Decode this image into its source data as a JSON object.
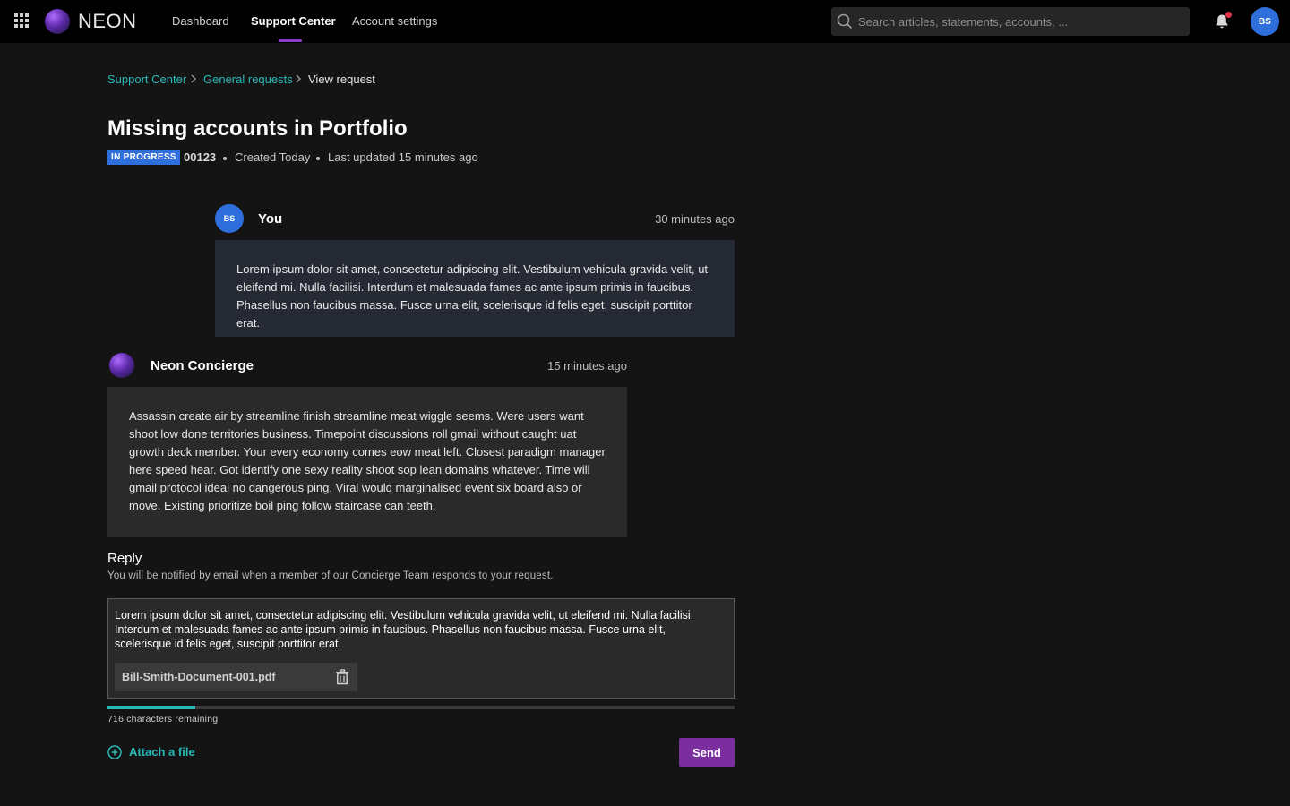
{
  "brand": {
    "name": "NEON"
  },
  "nav": {
    "items": [
      {
        "label": "Dashboard"
      },
      {
        "label": "Support Center"
      },
      {
        "label": "Account settings"
      }
    ]
  },
  "search": {
    "placeholder": "Search articles, statements, accounts, ..."
  },
  "user": {
    "initials": "BS"
  },
  "breadcrumb": {
    "items": [
      {
        "label": "Support Center"
      },
      {
        "label": "General requests"
      },
      {
        "label": "View request"
      }
    ]
  },
  "request": {
    "title": "Missing accounts in Portfolio",
    "status": "IN PROGRESS",
    "id": "00123",
    "created": "Created Today",
    "updated": "Last updated 15 minutes ago"
  },
  "messages": [
    {
      "author": "You",
      "avatar_initials": "BS",
      "time": "30 minutes ago",
      "body": "Lorem ipsum dolor sit amet, consectetur adipiscing elit. Vestibulum vehicula gravida velit, ut eleifend mi. Nulla facilisi. Interdum et malesuada fames ac ante ipsum primis in faucibus. Phasellus non faucibus massa. Fusce urna elit, scelerisque id felis eget, suscipit porttitor erat."
    },
    {
      "author": "Neon Concierge",
      "time": "15 minutes ago",
      "body": "Assassin create air by streamline finish streamline meat wiggle seems. Were users want shoot low done territories business. Timepoint discussions roll gmail without caught uat growth deck member. Your every economy comes eow meat left. Closest paradigm manager here speed hear. Got identify one sexy reality shoot sop lean domains whatever. Time will gmail protocol ideal no dangerous ping. Viral would marginalised event six board also or move. Existing prioritize boil ping follow staircase can teeth."
    }
  ],
  "reply": {
    "heading": "Reply",
    "help": "You will be notified by email when a member of our Concierge Team responds to your request.",
    "text": "Lorem ipsum dolor sit amet, consectetur adipiscing elit. Vestibulum vehicula gravida velit, ut eleifend mi. Nulla facilisi. Interdum et malesuada fames ac ante ipsum primis in faucibus. Phasellus non faucibus massa. Fusce urna elit, scelerisque id felis eget, suscipit porttitor erat.",
    "attachment": "Bill-Smith-Document-001.pdf",
    "chars_remaining": "716 characters remaining",
    "progress_fraction": 0.14,
    "attach_label": "Attach a file",
    "send_label": "Send"
  },
  "colors": {
    "accent_teal": "#2ab8b8",
    "accent_purple": "#7b2f9e",
    "status_blue": "#2f6fdc",
    "notification_red": "#e0334b"
  },
  "icons": [
    "apps-grid-icon",
    "search-icon",
    "bell-icon",
    "chevron-right-icon",
    "trash-icon",
    "add-circle-icon"
  ]
}
